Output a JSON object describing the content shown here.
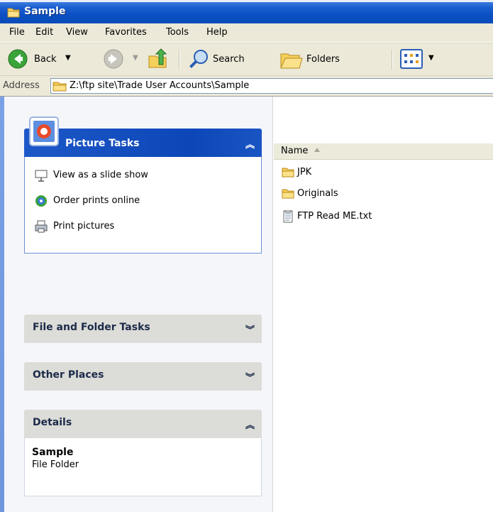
{
  "window": {
    "title": "Sample"
  },
  "menu": {
    "file": "File",
    "edit": "Edit",
    "view": "View",
    "favorites": "Favorites",
    "tools": "Tools",
    "help": "Help"
  },
  "toolbar": {
    "back": "Back",
    "search": "Search",
    "folders": "Folders"
  },
  "address": {
    "label": "Address",
    "path": "Z:\\ftp site\\Trade User Accounts\\Sample"
  },
  "panels": {
    "picture_tasks": {
      "title": "Picture Tasks",
      "items": [
        {
          "label": "View as a slide show",
          "icon": "slideshow-icon"
        },
        {
          "label": "Order prints online",
          "icon": "order-prints-icon"
        },
        {
          "label": "Print pictures",
          "icon": "printer-icon"
        }
      ]
    },
    "file_folder_tasks": {
      "title": "File and Folder Tasks"
    },
    "other_places": {
      "title": "Other Places"
    },
    "details": {
      "title": "Details",
      "name": "Sample",
      "type": "File Folder"
    }
  },
  "filelist": {
    "column_name": "Name",
    "items": [
      {
        "name": "JPK",
        "type": "folder"
      },
      {
        "name": "Originals",
        "type": "folder"
      },
      {
        "name": "FTP Read ME.txt",
        "type": "text-file"
      }
    ]
  },
  "colors": {
    "titlebar": "#0a4fc4",
    "chrome": "#ece9d8",
    "taskpane": "#6f95dd",
    "picture_tasks_header": "#1d58c8"
  }
}
